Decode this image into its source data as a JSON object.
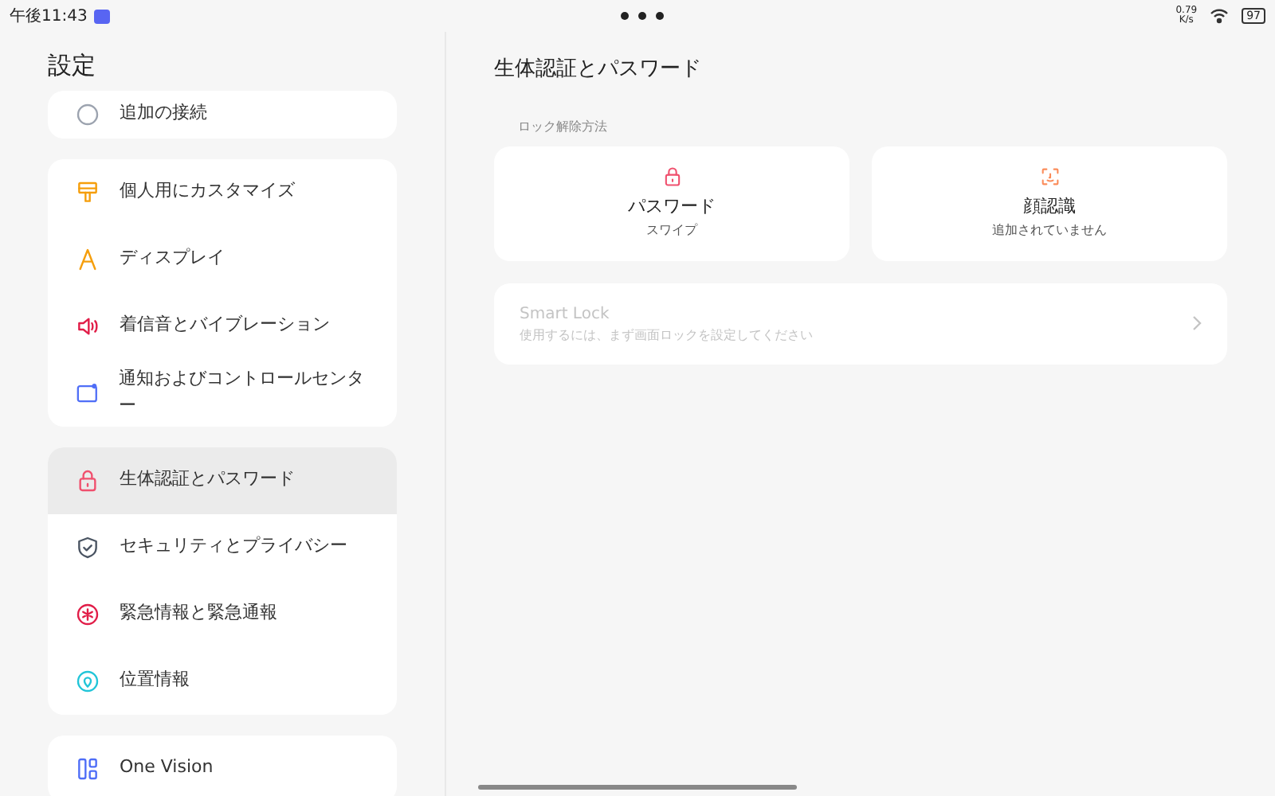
{
  "status_bar": {
    "time": "午後11:43",
    "speed_value": "0.79",
    "speed_unit": "K/s",
    "battery": "97"
  },
  "sidebar": {
    "title": "設定",
    "groups": [
      {
        "items": [
          {
            "label": "追加の接続",
            "kind": "connections",
            "selected": false
          }
        ]
      },
      {
        "items": [
          {
            "label": "個人用にカスタマイズ",
            "kind": "customize",
            "selected": false
          },
          {
            "label": "ディスプレイ",
            "kind": "display",
            "selected": false
          },
          {
            "label": "着信音とバイブレーション",
            "kind": "sound",
            "selected": false
          },
          {
            "label": "通知およびコントロールセンター",
            "kind": "notifications",
            "selected": false
          }
        ]
      },
      {
        "items": [
          {
            "label": "生体認証とパスワード",
            "kind": "lock",
            "selected": true
          },
          {
            "label": "セキュリティとプライバシー",
            "kind": "shield",
            "selected": false
          },
          {
            "label": "緊急情報と緊急通報",
            "kind": "emergency",
            "selected": false
          },
          {
            "label": "位置情報",
            "kind": "location",
            "selected": false
          }
        ]
      },
      {
        "items": [
          {
            "label": "One Vision",
            "kind": "vision",
            "selected": false
          }
        ]
      }
    ]
  },
  "main": {
    "title": "生体認証とパスワード",
    "section_label": "ロック解除方法",
    "methods": [
      {
        "kind": "lock",
        "title": "パスワード",
        "subtitle": "スワイプ"
      },
      {
        "kind": "face",
        "title": "顔認識",
        "subtitle": "追加されていません"
      }
    ],
    "smart_lock": {
      "title": "Smart Lock",
      "subtitle": "使用するには、まず画面ロックを設定してください",
      "disabled": true
    }
  }
}
